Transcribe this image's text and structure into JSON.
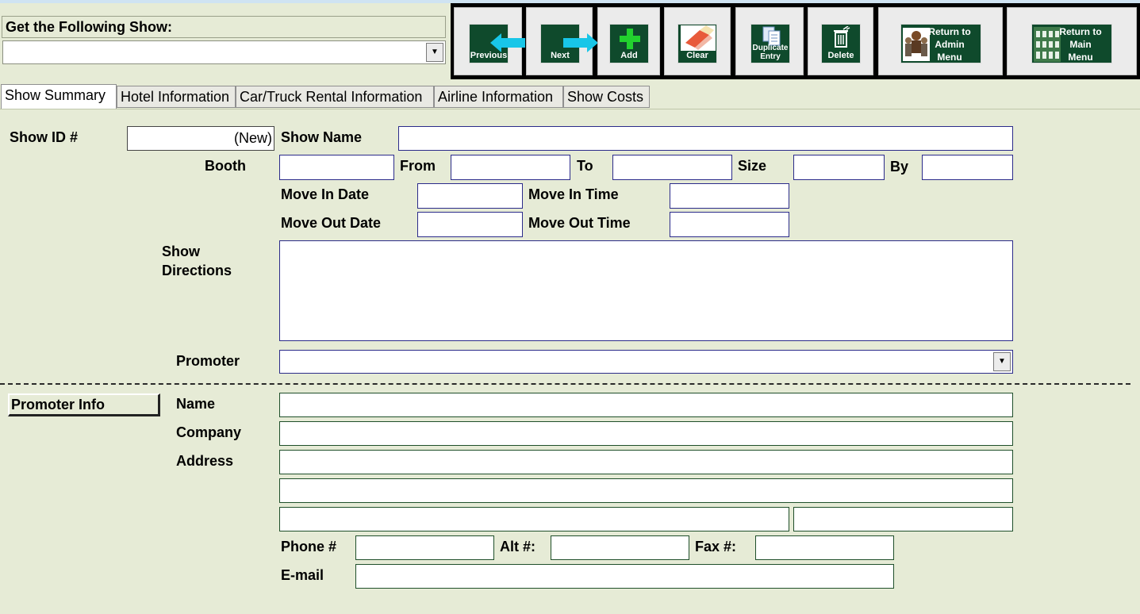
{
  "show_selector": {
    "label": "Get the Following Show:",
    "value": ""
  },
  "toolbar": {
    "previous": "Previous",
    "next": "Next",
    "add": "Add",
    "clear": "Clear",
    "duplicate_line1": "Duplicate",
    "duplicate_line2": "Entry",
    "delete": "Delete",
    "return_admin_l1": "Return to",
    "return_admin_l2": "Admin",
    "return_admin_l3": "Menu",
    "return_main_l1": "Return to",
    "return_main_l2": "Main",
    "return_main_l3": "Menu"
  },
  "tabs": [
    {
      "label": "Show Summary"
    },
    {
      "label": "Hotel Information"
    },
    {
      "label": "Car/Truck Rental Information"
    },
    {
      "label": "Airline Information"
    },
    {
      "label": "Show Costs"
    }
  ],
  "form": {
    "show_id_label": "Show ID #",
    "show_id_value": "(New)",
    "show_name_label": "Show Name",
    "booth_label": "Booth",
    "from_label": "From",
    "to_label": "To",
    "size_label": "Size",
    "by_label": "By",
    "move_in_date_label": "Move In Date",
    "move_in_time_label": "Move In Time",
    "move_out_date_label": "Move Out Date",
    "move_out_time_label": "Move Out Time",
    "show_directions_l1": "Show",
    "show_directions_l2": "Directions",
    "promoter_label": "Promoter"
  },
  "promoter_info": {
    "header": "Promoter Info",
    "name_label": "Name",
    "company_label": "Company",
    "address_label": "Address",
    "phone_label": "Phone #",
    "alt_label": "Alt #:",
    "fax_label": "Fax #:",
    "email_label": "E-mail"
  },
  "colors": {
    "background": "#e6ebd6",
    "toolbar_icon": "#0f4a2c",
    "arrow": "#18c6e8",
    "plus": "#22d12e"
  }
}
